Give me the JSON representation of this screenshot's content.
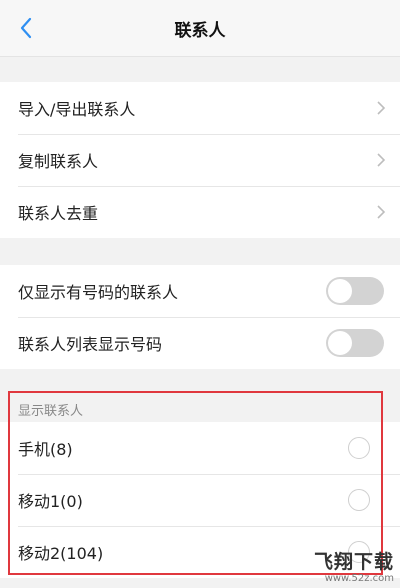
{
  "header": {
    "title": "联系人",
    "back_icon": "chevron-left-icon",
    "accent": "#2f8ff2"
  },
  "menu_group": {
    "items": [
      {
        "label": "导入/导出联系人"
      },
      {
        "label": "复制联系人"
      },
      {
        "label": "联系人去重"
      }
    ]
  },
  "toggle_group": {
    "items": [
      {
        "label": "仅显示有号码的联系人",
        "on": false
      },
      {
        "label": "联系人列表显示号码",
        "on": false
      }
    ]
  },
  "display_section": {
    "label": "显示联系人",
    "options": [
      {
        "label": "手机(8)",
        "selected": false
      },
      {
        "label": "移动1(0)",
        "selected": false
      },
      {
        "label": "移动2(104)",
        "selected": false
      }
    ]
  },
  "watermark": {
    "text": "飞翔下载",
    "url": "www.52z.com"
  },
  "colors": {
    "highlight": "#e0383e",
    "toggle_off": "#d3d3d3"
  }
}
